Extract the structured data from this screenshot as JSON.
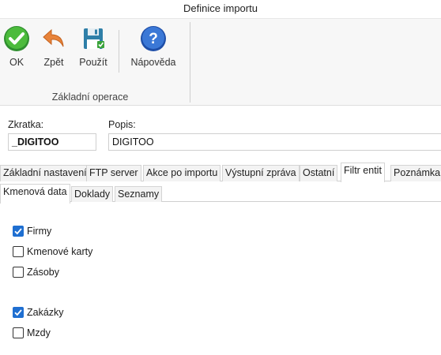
{
  "window": {
    "title": "Definice importu"
  },
  "ribbon": {
    "buttons": [
      {
        "label": "OK",
        "icon": "check-circle-icon"
      },
      {
        "label": "Zpět",
        "icon": "undo-arrow-icon"
      },
      {
        "label": "Použít",
        "icon": "floppy-disk-icon"
      },
      {
        "label": "Nápověda",
        "icon": "help-question-icon"
      }
    ],
    "group_label": "Základní operace"
  },
  "form": {
    "zkratka_label": "Zkratka:",
    "zkratka_value": "_DIGITOO",
    "popis_label": "Popis:",
    "popis_value": "DIGITOO"
  },
  "tabs": [
    {
      "label": "Základní nastavení",
      "active": false
    },
    {
      "label": "FTP server",
      "active": false
    },
    {
      "label": "Akce po importu",
      "active": false
    },
    {
      "label": "Výstupní zpráva",
      "active": false
    },
    {
      "label": "Ostatní",
      "active": false
    },
    {
      "label": "Filtr entit",
      "active": true
    },
    {
      "label": "Poznámka",
      "active": false
    }
  ],
  "subtabs": [
    {
      "label": "Kmenová data",
      "active": true
    },
    {
      "label": "Doklady",
      "active": false
    },
    {
      "label": "Seznamy",
      "active": false
    }
  ],
  "checkboxes": [
    {
      "label": "Firmy",
      "checked": true
    },
    {
      "label": "Kmenové karty",
      "checked": false
    },
    {
      "label": "Zásoby",
      "checked": false
    },
    {
      "label": "Zakázky",
      "checked": true
    },
    {
      "label": "Mzdy",
      "checked": false
    }
  ],
  "colors": {
    "accent": "#1f6fd1",
    "ok_green": "#3aa33a",
    "back_orange": "#e8833a",
    "help_blue": "#2f67c7"
  }
}
